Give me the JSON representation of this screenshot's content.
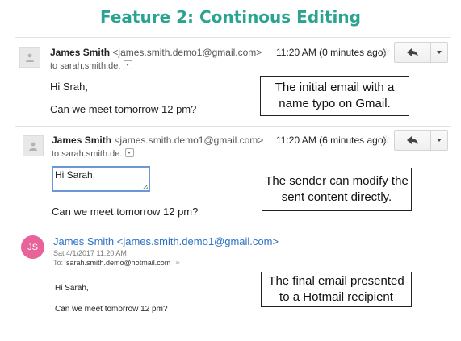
{
  "title": "Feature 2: Continous Editing",
  "email1": {
    "sender_name": "James Smith",
    "sender_email": "<james.smith.demo1@gmail.com>",
    "to": "to sarah.smith.de.",
    "time": "11:20 AM (0 minutes ago)",
    "greeting": "Hi Srah,",
    "body": "Can we meet tomorrow 12 pm?",
    "callout": "The initial email with a name typo on Gmail."
  },
  "email2": {
    "sender_name": "James Smith",
    "sender_email": "<james.smith.demo1@gmail.com>",
    "to": "to sarah.smith.de.",
    "time": "11:20 AM (6 minutes ago)",
    "editing_text": "Hi Sarah,",
    "body": "Can we meet tomorrow 12 pm?",
    "callout": "The sender can modify the sent content directly."
  },
  "email3": {
    "avatar_initials": "JS",
    "sender": "James Smith <james.smith.demo1@gmail.com>",
    "date": "Sat 4/1/2017 11:20 AM",
    "to_label": "To:",
    "to": "sarah.smith.demo@hotmail.com",
    "greeting": "Hi Sarah,",
    "body": "Can we meet tomorrow 12 pm?",
    "callout": "The final email presented to a Hotmail recipient"
  },
  "colors": {
    "title": "#2aa390",
    "avatar_js": "#e8639a",
    "link": "#2b72c6",
    "edit_border": "#6a97d8"
  }
}
